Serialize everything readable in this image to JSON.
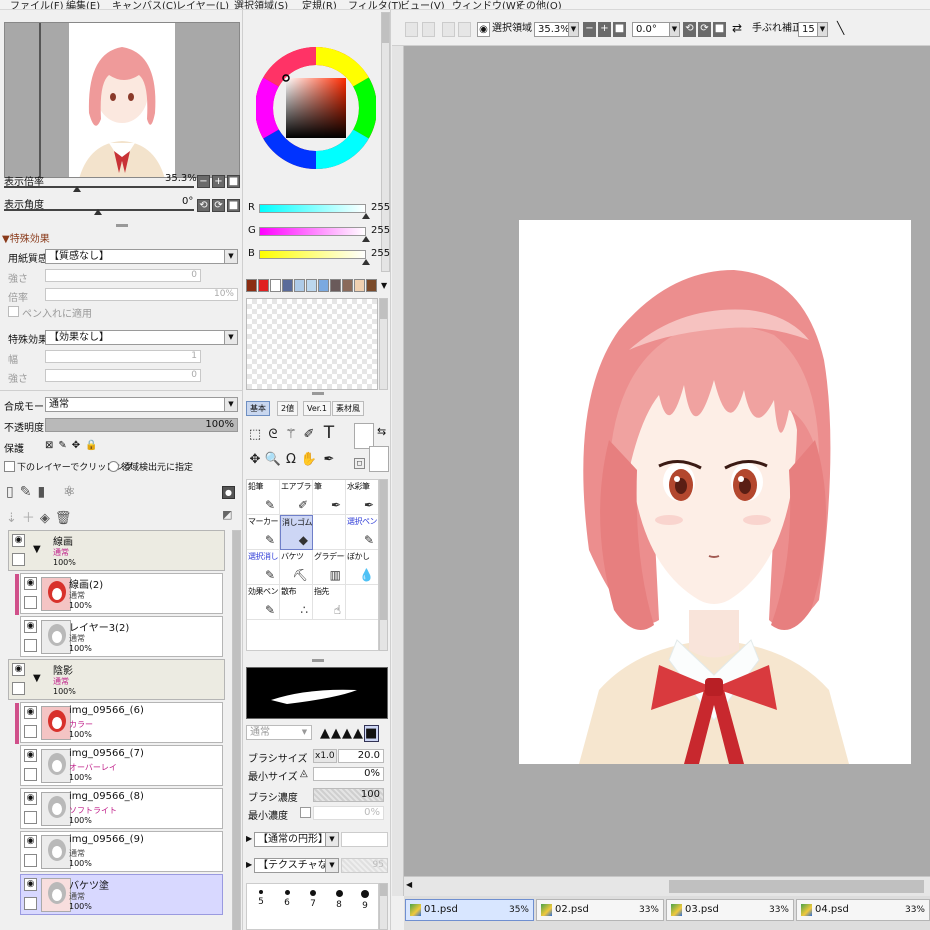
{
  "menu": [
    "ファイル(F)",
    "編集(E)",
    "キャンバス(C)",
    "レイヤー(L)",
    "選択領域(S)",
    "定規(R)",
    "フィルタ(T)",
    "ビュー(V)",
    "ウィンドウ(W)",
    "その他(O)"
  ],
  "navigator": {
    "zoom_label": "表示倍率",
    "zoom_value": "35.3%",
    "angle_label": "表示角度",
    "angle_value": "0°",
    "minus": "−",
    "plus": "+",
    "reset": "■",
    "rot_left": "⟲",
    "rot_right": "⟳"
  },
  "effects": {
    "header": "特殊効果",
    "paper_label": "用紙質感",
    "paper_value": "【質感なし】",
    "strength_label": "強さ",
    "strength_value": "0",
    "scale_label": "倍率",
    "scale_value": "10%",
    "pen_apply": "ペン入れに適用",
    "effect_label": "特殊効果",
    "effect_value": "【効果なし】",
    "width_label": "幅",
    "width_value": "1",
    "strength2_label": "強さ",
    "strength2_value": "0"
  },
  "layer_props": {
    "blend_label": "合成モード",
    "blend_value": "通常",
    "opacity_label": "不透明度",
    "opacity_value": "100%",
    "protect_label": "保護",
    "clip_label": "下のレイヤーでクリッピング",
    "source_label": "領域検出元に指定"
  },
  "layers": [
    {
      "name": "線画",
      "mode": "通常",
      "opacity": "100%",
      "folder": true
    },
    {
      "name": "線画(2)",
      "mode": "通常",
      "opacity": "100%",
      "pink": true
    },
    {
      "name": "レイヤー3(2)",
      "mode": "通常",
      "opacity": "100%"
    },
    {
      "name": "陰影",
      "mode": "通常",
      "opacity": "100%",
      "folder": true
    },
    {
      "name": "img_09566_(6)",
      "mode": "カラー",
      "opacity": "100%",
      "pink": true
    },
    {
      "name": "img_09566_(7)",
      "mode": "オーバーレイ",
      "opacity": "100%"
    },
    {
      "name": "img_09566_(8)",
      "mode": "ソフトライト",
      "opacity": "100%"
    },
    {
      "name": "img_09566_(9)",
      "mode": "通常",
      "opacity": "100%"
    },
    {
      "name": "バケツ塗",
      "mode": "通常",
      "opacity": "100%",
      "selected": true
    }
  ],
  "color": {
    "r_label": "R",
    "r_value": "255",
    "g_label": "G",
    "g_value": "255",
    "b_label": "B",
    "b_value": "255",
    "swatches": [
      "#8b2d12",
      "#e02020",
      "#ffffff",
      "#5a6b9a",
      "#aecbe8",
      "#bcd7ee",
      "#7aa9e0",
      "#6a5a5a",
      "#8a6a5a",
      "#f0d0b0",
      "#7a4a2a"
    ]
  },
  "tool_tabs": [
    "基本",
    "2値",
    "Ver.1",
    "素材風"
  ],
  "brushes": [
    {
      "label": "鉛筆",
      "icon": "✎"
    },
    {
      "label": "エアブラシ",
      "icon": "✐"
    },
    {
      "label": "筆",
      "icon": "✒"
    },
    {
      "label": "水彩筆",
      "icon": "✒"
    },
    {
      "label": "マーカー",
      "icon": "✎"
    },
    {
      "label": "消しゴム",
      "icon": "◆",
      "selected": true
    },
    {
      "label": "",
      "icon": ""
    },
    {
      "label": "選択ペン",
      "icon": "✎",
      "blue": true
    },
    {
      "label": "選択消し",
      "icon": "✎",
      "blue": true
    },
    {
      "label": "バケツ",
      "icon": "⛏"
    },
    {
      "label": "グラデーション",
      "icon": "▥"
    },
    {
      "label": "ぼかし",
      "icon": "💧"
    },
    {
      "label": "効果ペン",
      "icon": "✎"
    },
    {
      "label": "散布",
      "icon": "∴"
    },
    {
      "label": "指先",
      "icon": "☝"
    },
    {
      "label": "",
      "icon": ""
    }
  ],
  "brush_settings": {
    "mode_value": "通常",
    "size_label": "ブラシサイズ",
    "size_mult": "x1.0",
    "size_value": "20.0",
    "min_size_label": "最小サイズ",
    "min_size_value": "0%",
    "density_label": "ブラシ濃度",
    "density_value": "100",
    "min_density_label": "最小濃度",
    "min_density_value": "0%",
    "shape_value": "【通常の円形】",
    "texture_value": "【テクスチャなし】",
    "texture_num": "95"
  },
  "dot_sizes": [
    "5",
    "6",
    "7",
    "8",
    "9"
  ],
  "toolbar": {
    "selection_label": "選択領域",
    "zoom_value": "35.3%",
    "angle_value": "0.0°",
    "stabilizer_label": "手ぶれ補正",
    "stabilizer_value": "15"
  },
  "files": [
    {
      "name": "01.psd",
      "percent": "35%",
      "active": true
    },
    {
      "name": "02.psd",
      "percent": "33%"
    },
    {
      "name": "03.psd",
      "percent": "33%"
    },
    {
      "name": "04.psd",
      "percent": "33%"
    }
  ]
}
